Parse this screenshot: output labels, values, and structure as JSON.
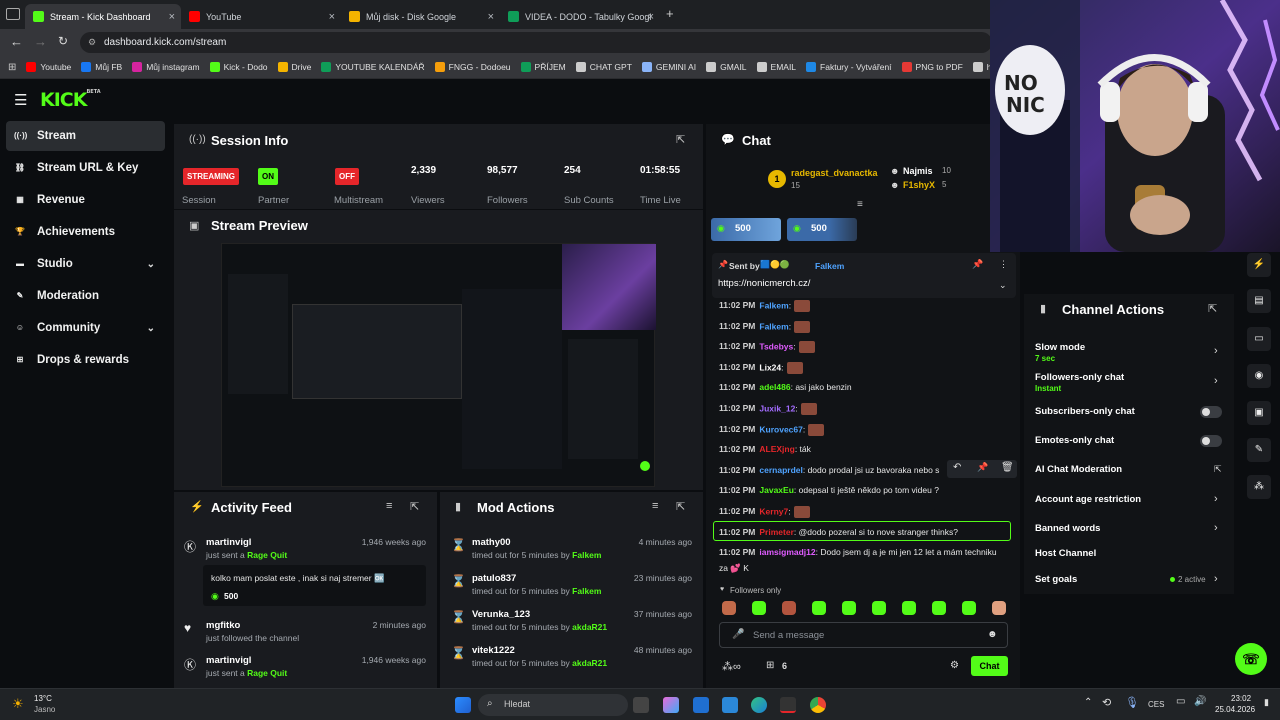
{
  "browser": {
    "tabs": [
      {
        "title": "Stream - Kick Dashboard",
        "color": "#53fc18"
      },
      {
        "title": "YouTube",
        "color": "#ff0000"
      },
      {
        "title": "Můj disk - Disk Google",
        "color": "#f4b400"
      },
      {
        "title": "VIDEA - DODO - Tabulky Googl",
        "color": "#0f9d58"
      }
    ],
    "new_tab": "+",
    "url": "dashboard.kick.com/stream",
    "bookmarks": [
      {
        "label": "Youtube",
        "color": "#ff0000"
      },
      {
        "label": "Můj FB",
        "color": "#1877f2"
      },
      {
        "label": "Můj instagram",
        "color": "#d6249f"
      },
      {
        "label": "Kick - Dodo",
        "color": "#53fc18"
      },
      {
        "label": "Drive",
        "color": "#f4b400"
      },
      {
        "label": "YOUTUBE KALENDÁŘ",
        "color": "#0f9d58"
      },
      {
        "label": "FNGG - Dodoeu",
        "color": "#f59e0b"
      },
      {
        "label": "PŘÍJEM",
        "color": "#0f9d58"
      },
      {
        "label": "CHAT GPT",
        "color": "#cccccc"
      },
      {
        "label": "GEMINI AI",
        "color": "#8ab4f8"
      },
      {
        "label": "GMAIL",
        "color": "#cccccc"
      },
      {
        "label": "EMAIL",
        "color": "#cccccc"
      },
      {
        "label": "Faktury - Vytváření",
        "color": "#1e88e5"
      },
      {
        "label": "PNG to PDF",
        "color": "#e53935"
      },
      {
        "label": "htt",
        "color": "#cccccc"
      }
    ]
  },
  "kick": {
    "logo": "KICK",
    "logo_beta": "BETA",
    "sidebar": [
      {
        "label": "Stream",
        "icon": "broadcast-icon",
        "glyph": "((·))",
        "chevron": ""
      },
      {
        "label": "Stream URL & Key",
        "icon": "link-icon",
        "glyph": "⛓",
        "chevron": ""
      },
      {
        "label": "Revenue",
        "icon": "chart-icon",
        "glyph": "▦",
        "chevron": ""
      },
      {
        "label": "Achievements",
        "icon": "trophy-icon",
        "glyph": "🏆",
        "chevron": ""
      },
      {
        "label": "Studio",
        "icon": "studio-icon",
        "glyph": "▬",
        "chevron": "⌄"
      },
      {
        "label": "Moderation",
        "icon": "wrench-icon",
        "glyph": "✎",
        "chevron": ""
      },
      {
        "label": "Community",
        "icon": "community-icon",
        "glyph": "☺",
        "chevron": "⌄"
      },
      {
        "label": "Drops & rewards",
        "icon": "gift-icon",
        "glyph": "⊞",
        "chevron": ""
      }
    ],
    "session": {
      "title": "Session Info",
      "items": [
        {
          "value": "STREAMING",
          "label": "Session",
          "badge_color": "#e5262a"
        },
        {
          "value": "ON",
          "label": "Partner",
          "badge_color": "#53fc18"
        },
        {
          "value": "OFF",
          "label": "Multistream",
          "badge_color": "#e5262a"
        }
      ],
      "stats": [
        {
          "value": "2,339",
          "label": "Viewers"
        },
        {
          "value": "98,577",
          "label": "Followers"
        },
        {
          "value": "254",
          "label": "Sub Counts"
        },
        {
          "value": "01:58:55",
          "label": "Time Live"
        }
      ]
    },
    "preview": {
      "title": "Stream Preview"
    },
    "activity": {
      "title": "Activity Feed",
      "items": [
        {
          "name": "martinvigl",
          "pre": "just sent a ",
          "highlight": "Rage Quit",
          "time": "1,946 weeks ago",
          "message": "kolko mam poslat este , inak si naj stremer 🆗",
          "amount": "500"
        },
        {
          "name": "mgfitko",
          "pre": "just followed the channel",
          "highlight": "",
          "time": "2 minutes ago"
        },
        {
          "name": "martinvigl",
          "pre": "just sent a ",
          "highlight": "Rage Quit",
          "time": "1,946 weeks ago"
        }
      ]
    },
    "mod_actions": {
      "title": "Mod Actions",
      "items": [
        {
          "name": "mathy00",
          "action": "timed out for 5 minutes by ",
          "mod": "Falkem",
          "time": "4 minutes ago"
        },
        {
          "name": "patulo837",
          "action": "timed out for 5 minutes by ",
          "mod": "Falkem",
          "time": "23 minutes ago"
        },
        {
          "name": "Verunka_123",
          "action": "timed out for 5 minutes by ",
          "mod": "akdaR21",
          "time": "37 minutes ago"
        },
        {
          "name": "vitek1222",
          "action": "timed out for 5 minutes by ",
          "mod": "akdaR21",
          "time": "48 minutes ago"
        }
      ]
    },
    "chat": {
      "title": "Chat",
      "top": [
        {
          "rank": "1",
          "name": "radegast_dvanactka",
          "count": "15",
          "color": "#e6b800"
        },
        {
          "rank": "",
          "name": "Najmis",
          "count": "10",
          "color": "#ffffff"
        },
        {
          "rank": "",
          "name": "F1shyX",
          "count": "5",
          "color": "#e6b800"
        }
      ],
      "goals": [
        "500",
        "500"
      ],
      "pinned": {
        "sent_by": "Sent by",
        "user": "Falkem",
        "link": "https://nonicmerch.cz/"
      },
      "messages": [
        {
          "time": "11:02 PM",
          "user": "Falkem",
          "color": "#4fa3ff",
          "text": ":",
          "emote": true
        },
        {
          "time": "11:02 PM",
          "user": "Falkem",
          "color": "#4fa3ff",
          "text": ":",
          "emote": true
        },
        {
          "time": "11:02 PM",
          "user": "Tsdebys",
          "color": "#e05cff",
          "text": ":",
          "emote": true
        },
        {
          "time": "11:02 PM",
          "user": "Lix24",
          "color": "#ffffff",
          "text": ":",
          "emote": true
        },
        {
          "time": "11:02 PM",
          "user": "adel486",
          "color": "#53fc18",
          "text": ": asi jako benzin",
          "emote": false
        },
        {
          "time": "11:02 PM",
          "user": "Juxik_12",
          "color": "#a36cff",
          "text": ":",
          "emote": true
        },
        {
          "time": "11:02 PM",
          "user": "Kurovec67",
          "color": "#4fa3ff",
          "text": ":",
          "emote": true
        },
        {
          "time": "11:02 PM",
          "user": "ALEXjng",
          "color": "#e5262a",
          "text": ": ták",
          "emote": false
        },
        {
          "time": "11:02 PM",
          "user": "cernaprdel",
          "color": "#4fa3ff",
          "text": ": dodo prodal jsi uz bavoraka nebo s",
          "emote": false
        },
        {
          "time": "11:02 PM",
          "user": "JavaxEu",
          "color": "#53fc18",
          "text": ": odepsal ti ještě někdo po tom videu ?",
          "emote": false
        },
        {
          "time": "11:02 PM",
          "user": "Kerny7",
          "color": "#e5262a",
          "text": ":",
          "emote": true
        },
        {
          "time": "11:02 PM",
          "user": "Primeter",
          "color": "#e5262a",
          "text": ": @dodo pozeral si to nove stranger thinks?",
          "emote": false
        },
        {
          "time": "11:02 PM",
          "user": "iamsigmadj12",
          "color": "#e05cff",
          "text": ": Dodo jsem dj a je mi jen 12 let a mám techniku",
          "emote": false
        }
      ],
      "wrap_text": "za 💕 K",
      "followers_only": "Followers only",
      "placeholder": "Send a message",
      "viewers_count": "6",
      "send_button": "Chat"
    },
    "channel_actions": {
      "title": "Channel Actions",
      "items": [
        {
          "label": "Slow mode",
          "sub": "7 sec",
          "control": "chevron"
        },
        {
          "label": "Followers-only chat",
          "sub": "Instant",
          "control": "chevron"
        },
        {
          "label": "Subscribers-only chat",
          "sub": "",
          "control": "toggle"
        },
        {
          "label": "Emotes-only chat",
          "sub": "",
          "control": "toggle"
        },
        {
          "label": "AI Chat Moderation",
          "sub": "",
          "control": "external"
        },
        {
          "label": "Account age restriction",
          "sub": "",
          "control": "chevron"
        },
        {
          "label": "Banned words",
          "sub": "",
          "control": "chevron"
        },
        {
          "label": "Host Channel",
          "sub": "",
          "control": "none"
        },
        {
          "label": "Set goals",
          "sub": "",
          "control": "chevron",
          "status": "2 active"
        }
      ]
    }
  },
  "taskbar": {
    "weather_temp": "13°C",
    "weather_desc": "Jasno",
    "search": "Hledat",
    "lang": "CES",
    "time": "23:02",
    "date": "25.04.2026"
  }
}
